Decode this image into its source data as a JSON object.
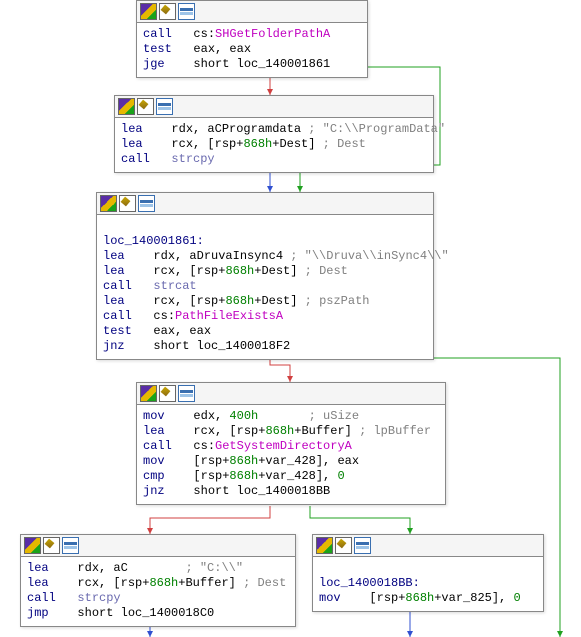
{
  "nodes": {
    "n1": {
      "lines": {
        "l1": {
          "mn": "call",
          "rest": "   cs:",
          "fn": "SHGetFolderPathA"
        },
        "l2": {
          "mn": "test",
          "rest": "   eax, eax"
        },
        "l3": {
          "mn": "jge",
          "rest": "    short loc_140001861"
        }
      }
    },
    "n2": {
      "lines": {
        "l1": {
          "mn": "lea",
          "rest": "    rdx, aCProgramdata ",
          "cmt": "; \"C:\\\\ProgramData\""
        },
        "l2": {
          "mn": "lea",
          "rest": "    rcx, [rsp+",
          "num": "868h",
          "rest2": "+Dest] ",
          "cmt": "; Dest"
        },
        "l3": {
          "mn": "call",
          "rest": "   ",
          "fn2": "strcpy"
        }
      }
    },
    "n3": {
      "label": "loc_140001861:",
      "lines": {
        "l1": {
          "mn": "lea",
          "rest": "    rdx, aDruvaInsync4 ",
          "cmt": "; \"\\\\Druva\\\\inSync4\\\\\""
        },
        "l2": {
          "mn": "lea",
          "rest": "    rcx, [rsp+",
          "num": "868h",
          "rest2": "+Dest] ",
          "cmt": "; Dest"
        },
        "l3": {
          "mn": "call",
          "rest": "   ",
          "fn2": "strcat"
        },
        "l4": {
          "mn": "lea",
          "rest": "    rcx, [rsp+",
          "num": "868h",
          "rest2": "+Dest] ",
          "cmt": "; pszPath"
        },
        "l5": {
          "mn": "call",
          "rest": "   cs:",
          "fn": "PathFileExistsA"
        },
        "l6": {
          "mn": "test",
          "rest": "   eax, eax"
        },
        "l7": {
          "mn": "jnz",
          "rest": "    short loc_1400018F2"
        }
      }
    },
    "n4": {
      "lines": {
        "l1": {
          "mn": "mov",
          "rest": "    edx, ",
          "num": "400h",
          "rest2": "       ",
          "cmt": "; uSize"
        },
        "l2": {
          "mn": "lea",
          "rest": "    rcx, [rsp+",
          "num": "868h",
          "rest2": "+Buffer] ",
          "cmt": "; lpBuffer"
        },
        "l3": {
          "mn": "call",
          "rest": "   cs:",
          "fn": "GetSystemDirectoryA"
        },
        "l4": {
          "mn": "mov",
          "rest": "    [rsp+",
          "num": "868h",
          "rest2": "+var_428], eax"
        },
        "l5": {
          "mn": "cmp",
          "rest": "    [rsp+",
          "num": "868h",
          "rest2": "+var_428], ",
          "num2": "0"
        },
        "l6": {
          "mn": "jnz",
          "rest": "    short loc_1400018BB"
        }
      }
    },
    "n5": {
      "lines": {
        "l1": {
          "mn": "lea",
          "rest": "    rdx, aC        ",
          "cmt": "; \"C:\\\\\""
        },
        "l2": {
          "mn": "lea",
          "rest": "    rcx, [rsp+",
          "num": "868h",
          "rest2": "+Buffer] ",
          "cmt": "; Dest"
        },
        "l3": {
          "mn": "call",
          "rest": "   ",
          "fn2": "strcpy"
        },
        "l4": {
          "mn": "jmp",
          "rest": "    short loc_1400018C0"
        }
      }
    },
    "n6": {
      "label": "loc_1400018BB:",
      "lines": {
        "l1": {
          "mn": "mov",
          "rest": "    [rsp+",
          "num": "868h",
          "rest2": "+var_825], ",
          "num2": "0"
        }
      }
    }
  }
}
